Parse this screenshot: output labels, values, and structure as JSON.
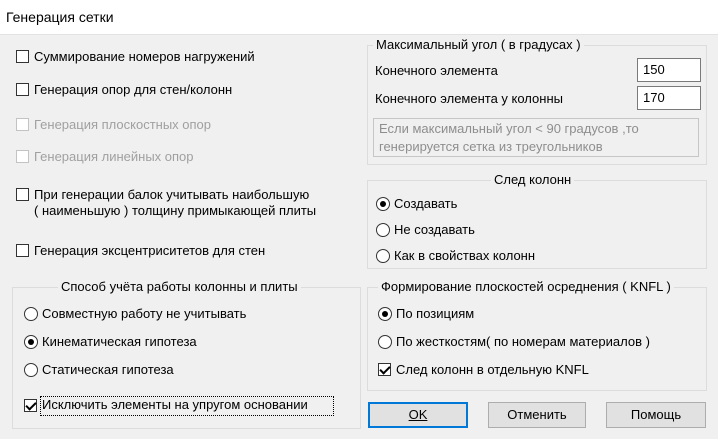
{
  "window": {
    "title": "Генерация сетки"
  },
  "left": {
    "sum_loads": {
      "label": "Суммирование номеров нагружений",
      "checked": false
    },
    "gen_supports_walls": {
      "label": "Генерация опор  для стен/колонн",
      "checked": false
    },
    "gen_planar_supports": {
      "label": "Генерация плоскостных опор",
      "checked": false,
      "disabled": true
    },
    "gen_linear_supports": {
      "label": "Генерация линейных опор",
      "checked": false,
      "disabled": true
    },
    "beam_thickness": {
      "line1": "При генерации балок учитывать  наибольшую",
      "line2": "( наименьшую ) толщину  примыкающей  плиты",
      "checked": false
    },
    "gen_eccentricities": {
      "label": "Генерация эксцентриситетов для стен",
      "checked": false
    }
  },
  "column_plate": {
    "title": "Способ учёта работы колонны и плиты",
    "options": [
      "Совместную работу не учитывать",
      "Кинематическая гипотеза",
      "Статическая гипотеза"
    ],
    "selected": "Кинематическая гипотеза",
    "exclude_elastic": {
      "label": "Исключить элементы на упругом основании",
      "checked": true
    }
  },
  "max_angle": {
    "title": "Максимальный угол  ( в градусах )",
    "finite_element_label": "Конечного элемента",
    "finite_element_value": "150",
    "column_element_label": "Конечного элемента у колонны",
    "column_element_value": "170",
    "note_line1": "Если максимальный  угол < 90 градусов ,то",
    "note_line2": "генерируется сетка из треугольников"
  },
  "column_trace": {
    "title": "След колонн",
    "options": [
      "Создавать",
      "Не создавать",
      "Как в свойствах колонн"
    ],
    "selected": "Создавать"
  },
  "knfl": {
    "title": "Формирование плоскостей осреднения  ( KNFL )",
    "options": [
      "По позициям",
      "По жесткостям( по номерам материалов )"
    ],
    "selected": "По позициям",
    "separate": {
      "label": "След колонн в отдельную KNFL",
      "checked": true
    }
  },
  "buttons": {
    "ok": "OK",
    "cancel": "Отменить",
    "help": "Помощь"
  }
}
